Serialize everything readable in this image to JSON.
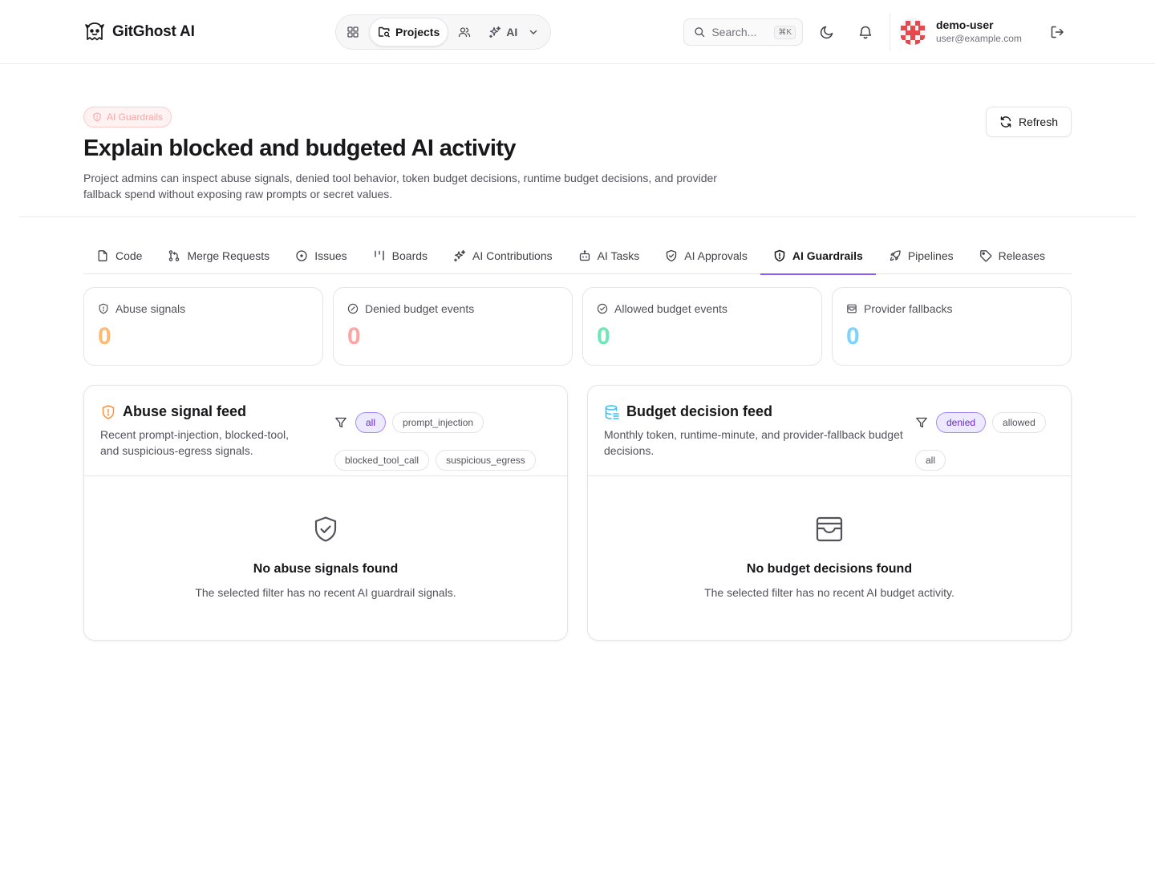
{
  "app": {
    "name": "GitGhost AI"
  },
  "nav": {
    "items": [
      {
        "id": "dashboard",
        "label": "",
        "icon": "dashboard-grid-icon"
      },
      {
        "id": "projects",
        "label": "Projects",
        "icon": "folder-search-icon",
        "active": true
      },
      {
        "id": "users",
        "label": "",
        "icon": "users-icon"
      },
      {
        "id": "ai",
        "label": "AI",
        "icon": "sparkles-icon"
      }
    ]
  },
  "search": {
    "placeholder": "Search...",
    "shortcut": "⌘K"
  },
  "user": {
    "name": "demo-user",
    "email": "user@example.com"
  },
  "page": {
    "badge": "AI Guardrails",
    "title": "Explain blocked and budgeted AI activity",
    "description": "Project admins can inspect abuse signals, denied tool behavior, token budget decisions, runtime budget decisions, and provider fallback spend without exposing raw prompts or secret values.",
    "refresh_label": "Refresh"
  },
  "tabs": [
    {
      "label": "Code",
      "icon": "file-icon"
    },
    {
      "label": "Merge Requests",
      "icon": "git-merge-icon"
    },
    {
      "label": "Issues",
      "icon": "circle-dot-icon"
    },
    {
      "label": "Boards",
      "icon": "kanban-icon"
    },
    {
      "label": "AI Contributions",
      "icon": "sparkles-icon"
    },
    {
      "label": "AI Tasks",
      "icon": "bot-icon"
    },
    {
      "label": "AI Approvals",
      "icon": "shield-check-icon"
    },
    {
      "label": "AI Guardrails",
      "icon": "shield-alert-icon",
      "active": true
    },
    {
      "label": "Pipelines",
      "icon": "rocket-icon"
    },
    {
      "label": "Releases",
      "icon": "tag-icon"
    }
  ],
  "stats": [
    {
      "label": "Abuse signals",
      "value": "0",
      "color": "#fdba74",
      "icon": "shield-alert-icon"
    },
    {
      "label": "Denied budget events",
      "value": "0",
      "color": "#fca5a5",
      "icon": "circle-slash-icon"
    },
    {
      "label": "Allowed budget events",
      "value": "0",
      "color": "#6ee7b7",
      "icon": "circle-check-icon"
    },
    {
      "label": "Provider fallbacks",
      "value": "0",
      "color": "#7dd3fc",
      "icon": "wallet-icon"
    }
  ],
  "abuse_feed": {
    "title": "Abuse signal feed",
    "description": "Recent prompt-injection, blocked-tool, and suspicious-egress signals.",
    "filters": [
      "all",
      "prompt_injection",
      "blocked_tool_call",
      "suspicious_egress"
    ],
    "active_filter": "all",
    "empty_title": "No abuse signals found",
    "empty_subtitle": "The selected filter has no recent AI guardrail signals."
  },
  "budget_feed": {
    "title": "Budget decision feed",
    "description": "Monthly token, runtime-minute, and provider-fallback budget decisions.",
    "filters": [
      "denied",
      "allowed",
      "all"
    ],
    "active_filter": "denied",
    "empty_title": "No budget decisions found",
    "empty_subtitle": "The selected filter has no recent AI budget activity."
  },
  "colors": {
    "accent": "#8b5cf6",
    "warning": "#fb923c",
    "info": "#38bdf8"
  }
}
